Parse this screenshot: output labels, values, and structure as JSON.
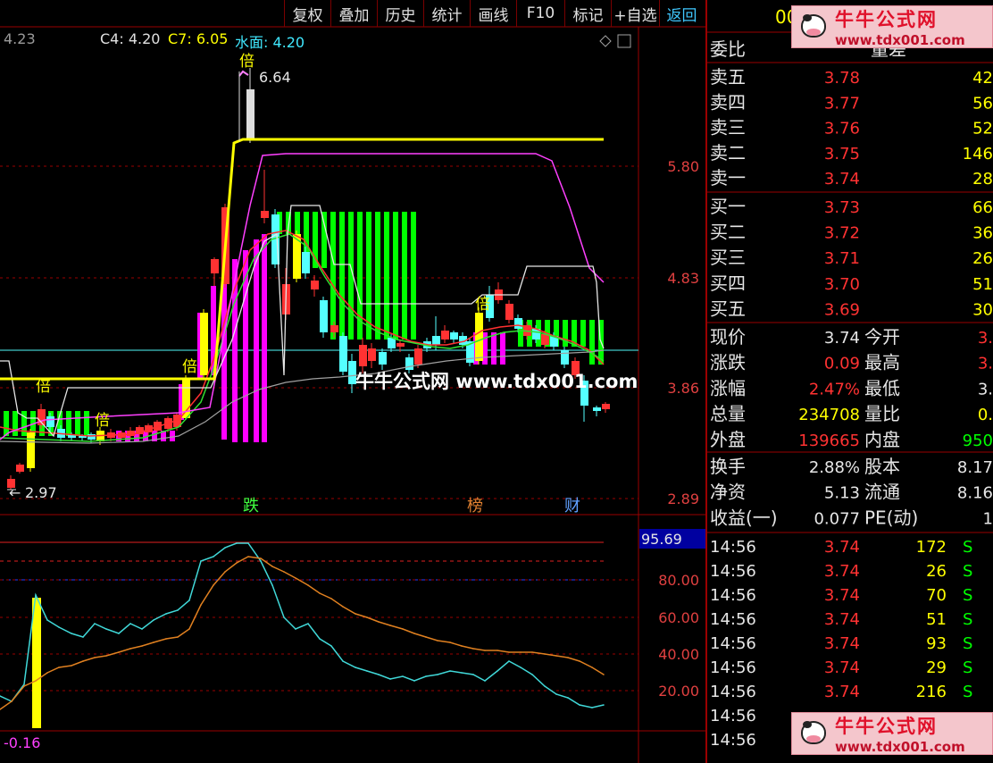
{
  "toolbar": {
    "buttons": [
      {
        "label": "复权"
      },
      {
        "label": "叠加"
      },
      {
        "label": "历史"
      },
      {
        "label": "统计"
      },
      {
        "label": "画线"
      },
      {
        "label": "F10"
      },
      {
        "label": "标记"
      },
      {
        "label": "+自选"
      },
      {
        "label": "返回"
      }
    ]
  },
  "info_line": {
    "left_value": "4.23",
    "c4": "C4: 4.20",
    "c7": "C7: 6.05",
    "water": "水面: 4.20"
  },
  "colors": {
    "up": "#ff3232",
    "down": "#54ffff",
    "yellow": "#ffff00",
    "magenta": "#ff00ff",
    "green": "#00ff00",
    "grid": "#9a0000",
    "white": "#e6e6e6"
  },
  "main_chart": {
    "price_labels": [
      "5.80",
      "4.83",
      "3.86",
      "2.89"
    ],
    "high_label": "6.64",
    "low_label": "2.97",
    "markers": [
      {
        "text": "倍"
      },
      {
        "text": "倍"
      },
      {
        "text": "倍"
      },
      {
        "text": "倍"
      },
      {
        "text": "倍"
      }
    ],
    "event_labels": [
      {
        "text": "跌"
      },
      {
        "text": "榜"
      },
      {
        "text": "财"
      }
    ]
  },
  "chart_data": {
    "type": "line",
    "title": "",
    "ylim": [
      0,
      100
    ],
    "y_ticks": [
      "80.00",
      "60.00",
      "40.00",
      "20.00"
    ],
    "current_value": "95.69",
    "bottom_value": "-0.16",
    "series": [
      {
        "values": [
          17,
          14,
          23,
          70,
          57,
          53,
          50,
          48,
          55,
          52,
          50,
          55,
          52,
          57,
          60,
          62,
          67,
          88,
          90,
          95,
          97,
          97,
          88,
          75,
          58,
          52,
          55,
          47,
          43,
          35,
          32,
          30,
          28,
          26,
          27,
          25,
          27,
          28,
          30,
          29,
          28,
          25,
          30,
          35,
          32,
          28,
          22,
          18,
          16,
          12,
          11,
          12
        ]
      },
      {
        "values": [
          10,
          14,
          22,
          25,
          29,
          32,
          33,
          35,
          37,
          38,
          40,
          42,
          43,
          45,
          47,
          48,
          52,
          65,
          75,
          82,
          87,
          90,
          89,
          85,
          82,
          79,
          75,
          71,
          68,
          64,
          60,
          58,
          56,
          54,
          52,
          50,
          48,
          46,
          45,
          43,
          42,
          41,
          41,
          40,
          40,
          40,
          39,
          38,
          37,
          35,
          32,
          28
        ]
      }
    ]
  },
  "sidebar": {
    "code_prefix": "00",
    "weibi_label": "委比",
    "liangbi_cut": "量差",
    "sells": [
      {
        "label": "卖五",
        "price": "3.78",
        "vol": "42"
      },
      {
        "label": "卖四",
        "price": "3.77",
        "vol": "56"
      },
      {
        "label": "卖三",
        "price": "3.76",
        "vol": "52"
      },
      {
        "label": "卖二",
        "price": "3.75",
        "vol": "146"
      },
      {
        "label": "卖一",
        "price": "3.74",
        "vol": "28"
      }
    ],
    "buys": [
      {
        "label": "买一",
        "price": "3.73",
        "vol": "66"
      },
      {
        "label": "买二",
        "price": "3.72",
        "vol": "36"
      },
      {
        "label": "买三",
        "price": "3.71",
        "vol": "26"
      },
      {
        "label": "买四",
        "price": "3.70",
        "vol": "51"
      },
      {
        "label": "买五",
        "price": "3.69",
        "vol": "30"
      }
    ],
    "quote_rows": [
      {
        "l1": "现价",
        "v1": "3.74",
        "l2": "今开",
        "v2": "3."
      },
      {
        "l1": "涨跌",
        "v1": "0.09",
        "l2": "最高",
        "v2": "3."
      },
      {
        "l1": "涨幅",
        "v1": "2.47%",
        "l2": "最低",
        "v2": "3."
      },
      {
        "l1": "总量",
        "v1": "234708",
        "l2": "量比",
        "v2": "0."
      },
      {
        "l1": "外盘",
        "v1": "139665",
        "l2": "内盘",
        "v2": "950"
      }
    ],
    "fin_rows": [
      {
        "l1": "换手",
        "v1": "2.88%",
        "l2": "股本",
        "v2": "8.17"
      },
      {
        "l1": "净资",
        "v1": "5.13",
        "l2": "流通",
        "v2": "8.16"
      },
      {
        "l1": "收益(一)",
        "v1": "0.077",
        "l2": "PE(动)",
        "v2": "1"
      }
    ],
    "ticks": [
      {
        "time": "14:56",
        "price": "3.74",
        "vol": "172",
        "side": "S"
      },
      {
        "time": "14:56",
        "price": "3.74",
        "vol": "26",
        "side": "S"
      },
      {
        "time": "14:56",
        "price": "3.74",
        "vol": "70",
        "side": "S"
      },
      {
        "time": "14:56",
        "price": "3.74",
        "vol": "51",
        "side": "S"
      },
      {
        "time": "14:56",
        "price": "3.74",
        "vol": "93",
        "side": "S"
      },
      {
        "time": "14:56",
        "price": "3.74",
        "vol": "29",
        "side": "S"
      },
      {
        "time": "14:56",
        "price": "3.74",
        "vol": "216",
        "side": "S"
      },
      {
        "time": "14:56",
        "price": "",
        "vol": "",
        "side": ""
      },
      {
        "time": "14:56",
        "price": "",
        "vol": "",
        "side": ""
      }
    ]
  },
  "watermark": {
    "center_text": "牛牛公式网 www.tdx001.com",
    "logo_cn": "牛牛公式网",
    "logo_url": "www.tdx001.com"
  }
}
